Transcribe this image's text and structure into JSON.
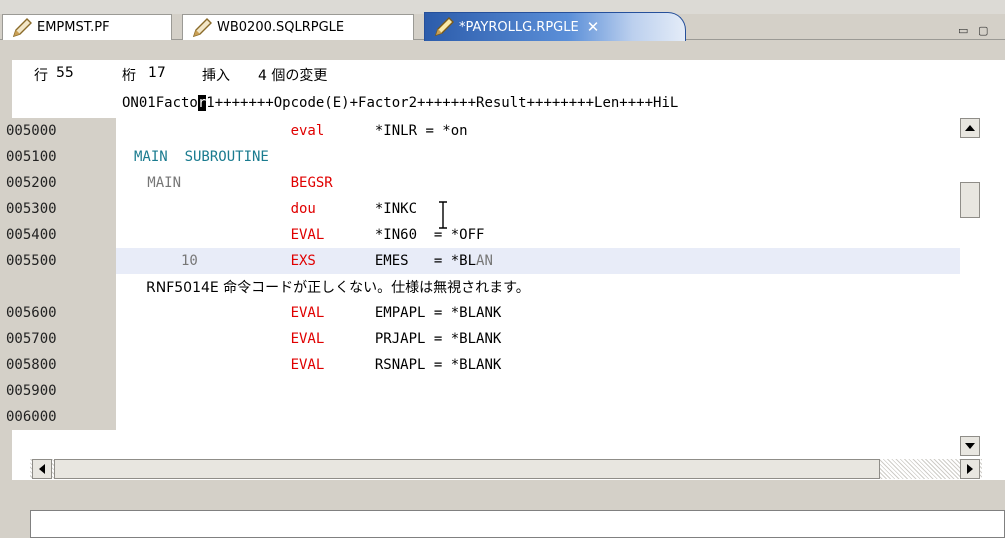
{
  "tabs": [
    {
      "label": "EMPMST.PF",
      "active": false
    },
    {
      "label": "WB0200.SQLRPGLE",
      "active": false
    },
    {
      "label": "*PAYROLLG.RPGLE",
      "active": true
    }
  ],
  "status": {
    "row_label": "行",
    "row_value": "55",
    "col_label": "桁",
    "col_value": "17",
    "mode": "挿入",
    "changes": "4 個の変更"
  },
  "ruler": {
    "before": "ON01Facto",
    "cursor_char": "r",
    "after": "1+++++++Opcode(E)+Factor2+++++++Result++++++++Len++++HiL"
  },
  "lines": [
    {
      "seq": "005000",
      "parts": [
        {
          "text": "                    ",
          "color": ""
        },
        {
          "text": "eval",
          "color": "red"
        },
        {
          "text": "      *INLR = *on",
          "color": ""
        }
      ]
    },
    {
      "seq": "005100",
      "parts": [
        {
          "text": "MAIN  SUBROUTINE",
          "color": "teal"
        }
      ]
    },
    {
      "seq": "005200",
      "parts": [
        {
          "text": "   MAIN            ",
          "color": "grey"
        },
        {
          "text": " BEGSR",
          "color": "red"
        }
      ]
    },
    {
      "seq": "005300",
      "parts": [
        {
          "text": "                    ",
          "color": ""
        },
        {
          "text": "dou",
          "color": "red"
        },
        {
          "text": "       *INKC",
          "color": ""
        }
      ]
    },
    {
      "seq": "005400",
      "parts": [
        {
          "text": "                    ",
          "color": ""
        },
        {
          "text": "EVAL",
          "color": "red"
        },
        {
          "text": "      *IN60  = *OFF",
          "color": ""
        }
      ]
    },
    {
      "seq": "005500",
      "highlight": true,
      "parts": [
        {
          "text": "       10           ",
          "color": "grey"
        },
        {
          "text": "EXS",
          "color": "red"
        },
        {
          "text": "       EMES   = *BL",
          "color": ""
        },
        {
          "text": "AN",
          "color": "grey"
        }
      ]
    },
    {
      "seq": "005600",
      "parts": [
        {
          "text": "                    ",
          "color": ""
        },
        {
          "text": "EVAL",
          "color": "red"
        },
        {
          "text": "      EMPAPL = *BLANK",
          "color": ""
        }
      ]
    },
    {
      "seq": "005700",
      "parts": [
        {
          "text": "                    ",
          "color": ""
        },
        {
          "text": "EVAL",
          "color": "red"
        },
        {
          "text": "      PRJAPL = *BLANK",
          "color": ""
        }
      ]
    },
    {
      "seq": "005800",
      "parts": [
        {
          "text": "                    ",
          "color": ""
        },
        {
          "text": "EVAL",
          "color": "red"
        },
        {
          "text": "      RSNAPL = *BLANK",
          "color": ""
        }
      ]
    },
    {
      "seq": "005900",
      "parts": []
    },
    {
      "seq": "006000",
      "parts": []
    }
  ],
  "error_message": "RNF5014E  命令コードが正しくない。仕様は無視されます。",
  "colors": {
    "red": "#e00000",
    "teal": "#1a7b8f",
    "grey": "#777777",
    "highlight": "#e8ecf8"
  },
  "icons": {
    "tab_icon": "pencil-icon",
    "close": "close-icon",
    "minimize": "minimize-icon",
    "maximize": "maximize-icon"
  },
  "close_glyph": "✕",
  "minimize_glyph": "▭",
  "maximize_glyph": "▢"
}
